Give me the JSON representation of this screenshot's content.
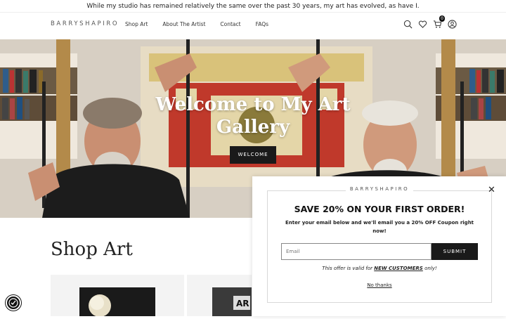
{
  "announcement": "While my studio has remained relatively the same over the past 30 years, my art has evolved, as have I.",
  "header": {
    "logo": "BARRYSHAPIRO",
    "nav": [
      "Shop Art",
      "About The Artist",
      "Contact",
      "FAQs"
    ],
    "cart_count": "0",
    "icons": [
      "search-icon",
      "heart-icon",
      "cart-icon",
      "account-icon"
    ]
  },
  "hero": {
    "title": "Welcome to My Art Gallery",
    "button_label": "WELCOME"
  },
  "shop": {
    "title": "Shop Art"
  },
  "popup": {
    "logo": "BARRYSHAPIRO",
    "headline": "SAVE 20% ON YOUR FIRST ORDER!",
    "subtext": "Enter your email below and we'll email you a 20% OFF Coupon right now!",
    "email_placeholder": "Email",
    "submit_label": "SUBMIT",
    "offer_prefix": "This offer is valid for",
    "offer_highlight": "NEW CUSTOMERS",
    "offer_suffix": "only!",
    "decline_label": "No thanks"
  },
  "colors": {
    "accent": "#1a1a1a",
    "background": "#ffffff"
  }
}
